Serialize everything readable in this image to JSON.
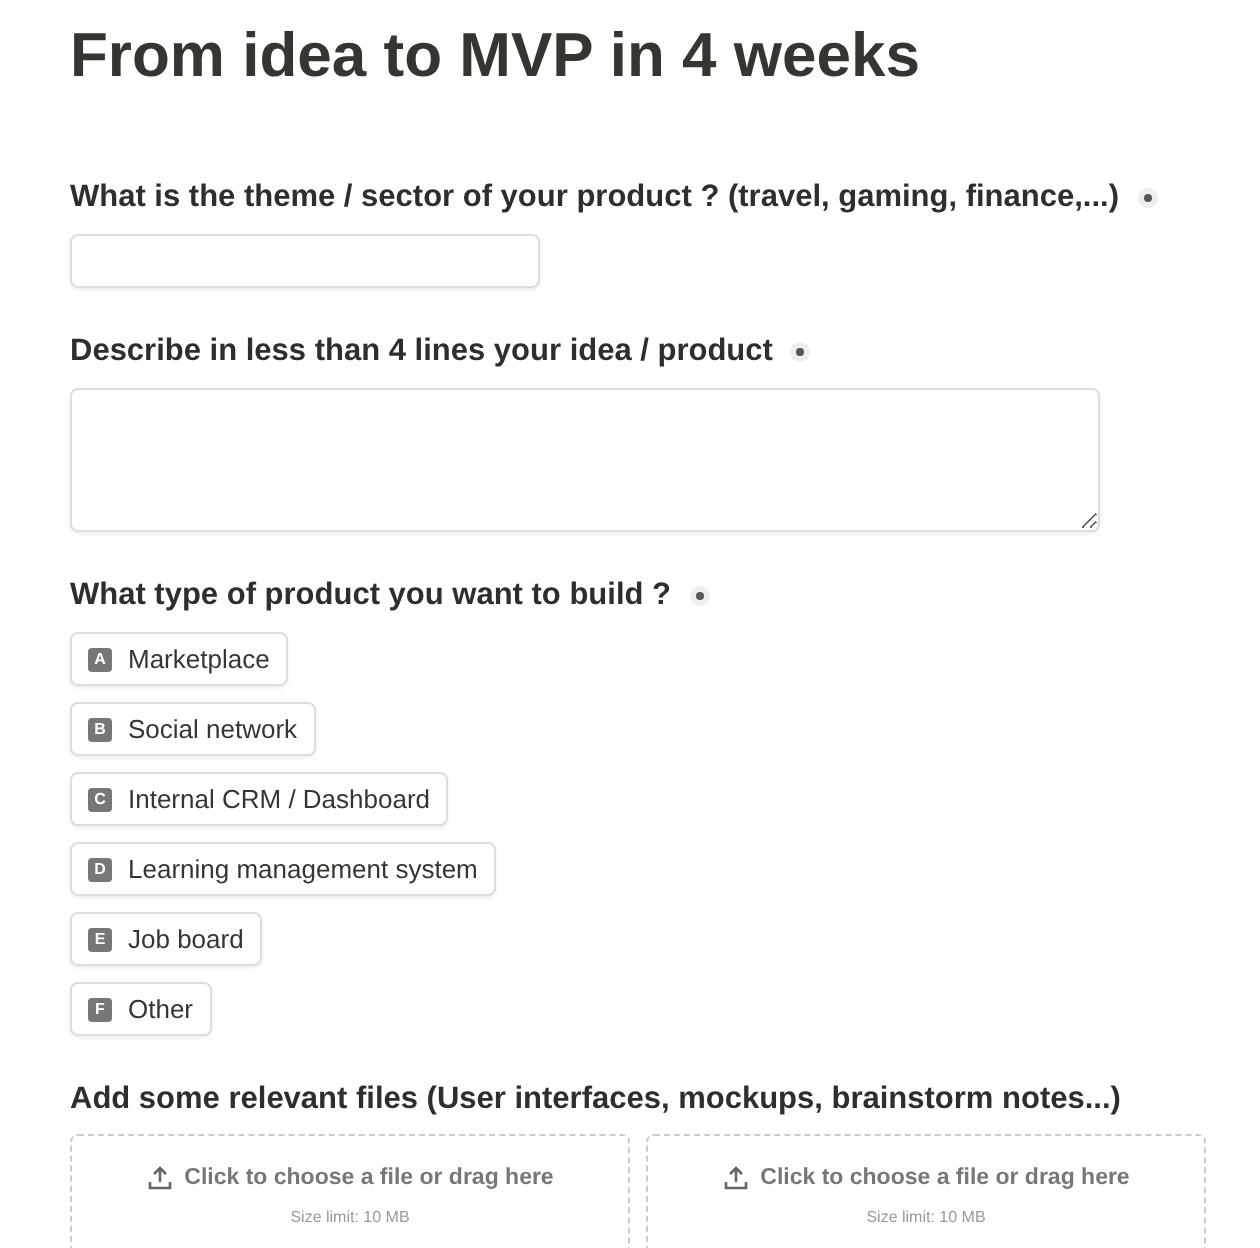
{
  "title": "From idea to MVP in 4 weeks",
  "questions": [
    {
      "kind": "text",
      "label": "What is the theme / sector of your product ? (travel, gaming, finance,...)",
      "required": true
    },
    {
      "kind": "textarea",
      "label": "Describe in less than 4 lines your idea / product",
      "required": true
    },
    {
      "kind": "choice",
      "label": "What type of product you want to build ?",
      "required": true,
      "options": [
        {
          "key": "A",
          "label": "Marketplace",
          "selected": false
        },
        {
          "key": "B",
          "label": "Social network",
          "selected": false
        },
        {
          "key": "C",
          "label": "Internal CRM / Dashboard",
          "selected": false
        },
        {
          "key": "D",
          "label": "Learning management system",
          "selected": false
        },
        {
          "key": "E",
          "label": "Job board",
          "selected": false
        },
        {
          "key": "F",
          "label": "Other",
          "selected": false
        }
      ]
    },
    {
      "kind": "files",
      "label": "Add some relevant files (User interfaces, mockups, brainstorm notes...)",
      "uploads": [
        {
          "prompt": "Click to choose a file or drag here",
          "limit": "Size limit: 10 MB"
        },
        {
          "prompt": "Click to choose a file or drag here",
          "limit": "Size limit: 10 MB"
        }
      ]
    }
  ]
}
